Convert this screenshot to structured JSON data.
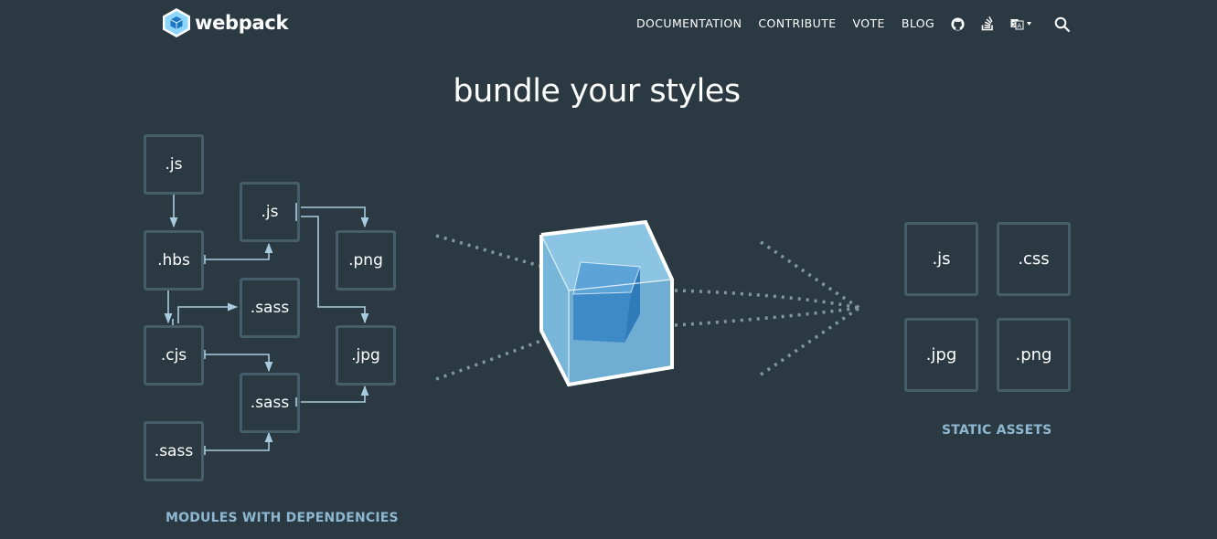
{
  "header": {
    "logo_text": "webpack",
    "nav": {
      "documentation": "DOCUMENTATION",
      "contribute": "CONTRIBUTE",
      "vote": "VOTE",
      "blog": "BLOG"
    },
    "icons": [
      "github-icon",
      "stack-overflow-icon",
      "language-icon",
      "search-icon"
    ]
  },
  "hero": {
    "title": "bundle your styles"
  },
  "modules": {
    "caption": "MODULES WITH DEPENDENCIES",
    "items": [
      ".js",
      ".hbs",
      ".cjs",
      ".sass",
      ".js",
      ".sass",
      ".sass",
      ".png",
      ".jpg"
    ]
  },
  "assets": {
    "caption": "STATIC ASSETS",
    "items": [
      ".js",
      ".css",
      ".jpg",
      ".png"
    ]
  },
  "colors": {
    "background": "#2b3a42",
    "box_border": "#465e69",
    "arrow": "#a9cbe0",
    "caption": "#8eb7d1",
    "cube_face": "#8ed6fb",
    "cube_inner": "#1c78c0"
  }
}
